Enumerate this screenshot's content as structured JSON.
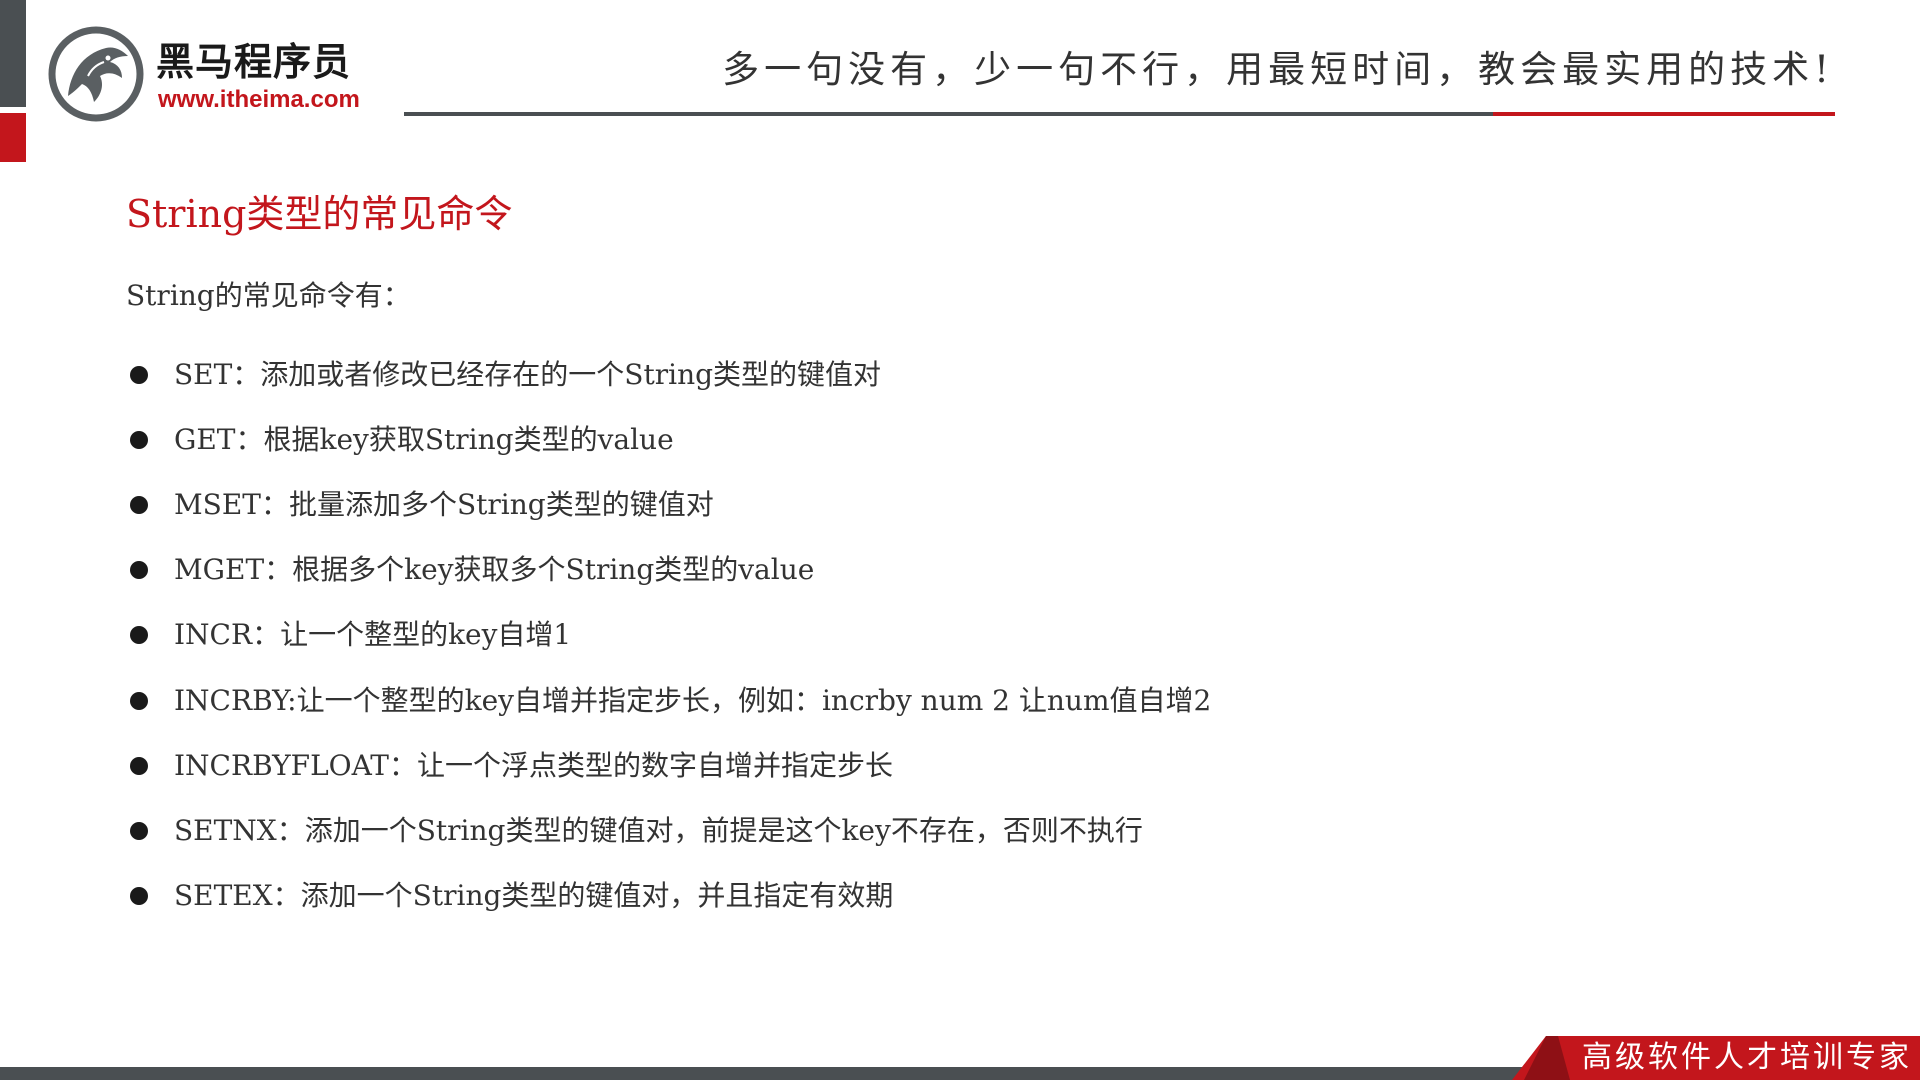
{
  "header": {
    "logo_name": "黑马程序员",
    "logo_url": "www.itheima.com",
    "slogan": "多一句没有，少一句不行，用最短时间，教会最实用的技术!"
  },
  "slide": {
    "title": "String类型的常见命令",
    "intro": "String的常见命令有：",
    "commands": [
      "SET：添加或者修改已经存在的一个String类型的键值对",
      "GET：根据key获取String类型的value",
      "MSET：批量添加多个String类型的键值对",
      "MGET：根据多个key获取多个String类型的value",
      "INCR：让一个整型的key自增1",
      "INCRBY:让一个整型的key自增并指定步长，例如：incrby num 2 让num值自增2",
      "INCRBYFLOAT：让一个浮点类型的数字自增并指定步长",
      "SETNX：添加一个String类型的键值对，前提是这个key不存在，否则不执行",
      "SETEX：添加一个String类型的键值对，并且指定有效期"
    ]
  },
  "footer": {
    "tagline": "高级软件人才培训专家"
  },
  "colors": {
    "brand_red": "#c3161c",
    "dark_gray": "#4a4f52",
    "text": "#333333"
  },
  "icons": {
    "logo": "horse-head-logo-icon",
    "bullet": "filled-circle-bullet-icon"
  }
}
